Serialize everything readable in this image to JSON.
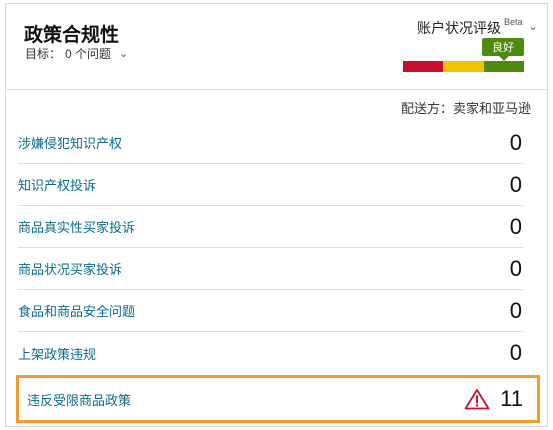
{
  "header": {
    "title": "政策合规性",
    "target_label": "目标：",
    "target_value": "0 个问题",
    "rating_label": "账户状况评级",
    "rating_beta": "Beta",
    "rating_badge": "良好"
  },
  "colors": {
    "bar_red": "#c8102e",
    "bar_yellow": "#f3c300",
    "bar_green": "#4f8a10",
    "link": "#0b6b8a",
    "highlight_border": "#f39c32",
    "warning": "#c8102e"
  },
  "shipped_by": "配送方：卖家和亚马逊",
  "rows": [
    {
      "label": "涉嫌侵犯知识产权",
      "value": "0"
    },
    {
      "label": "知识产权投诉",
      "value": "0"
    },
    {
      "label": "商品真实性买家投诉",
      "value": "0"
    },
    {
      "label": "商品状况买家投诉",
      "value": "0"
    },
    {
      "label": "食品和商品安全问题",
      "value": "0"
    },
    {
      "label": "上架政策违规",
      "value": "0"
    }
  ],
  "highlighted_row": {
    "label": "违反受限商品政策",
    "value": "11",
    "icon": "warning-triangle-icon"
  }
}
